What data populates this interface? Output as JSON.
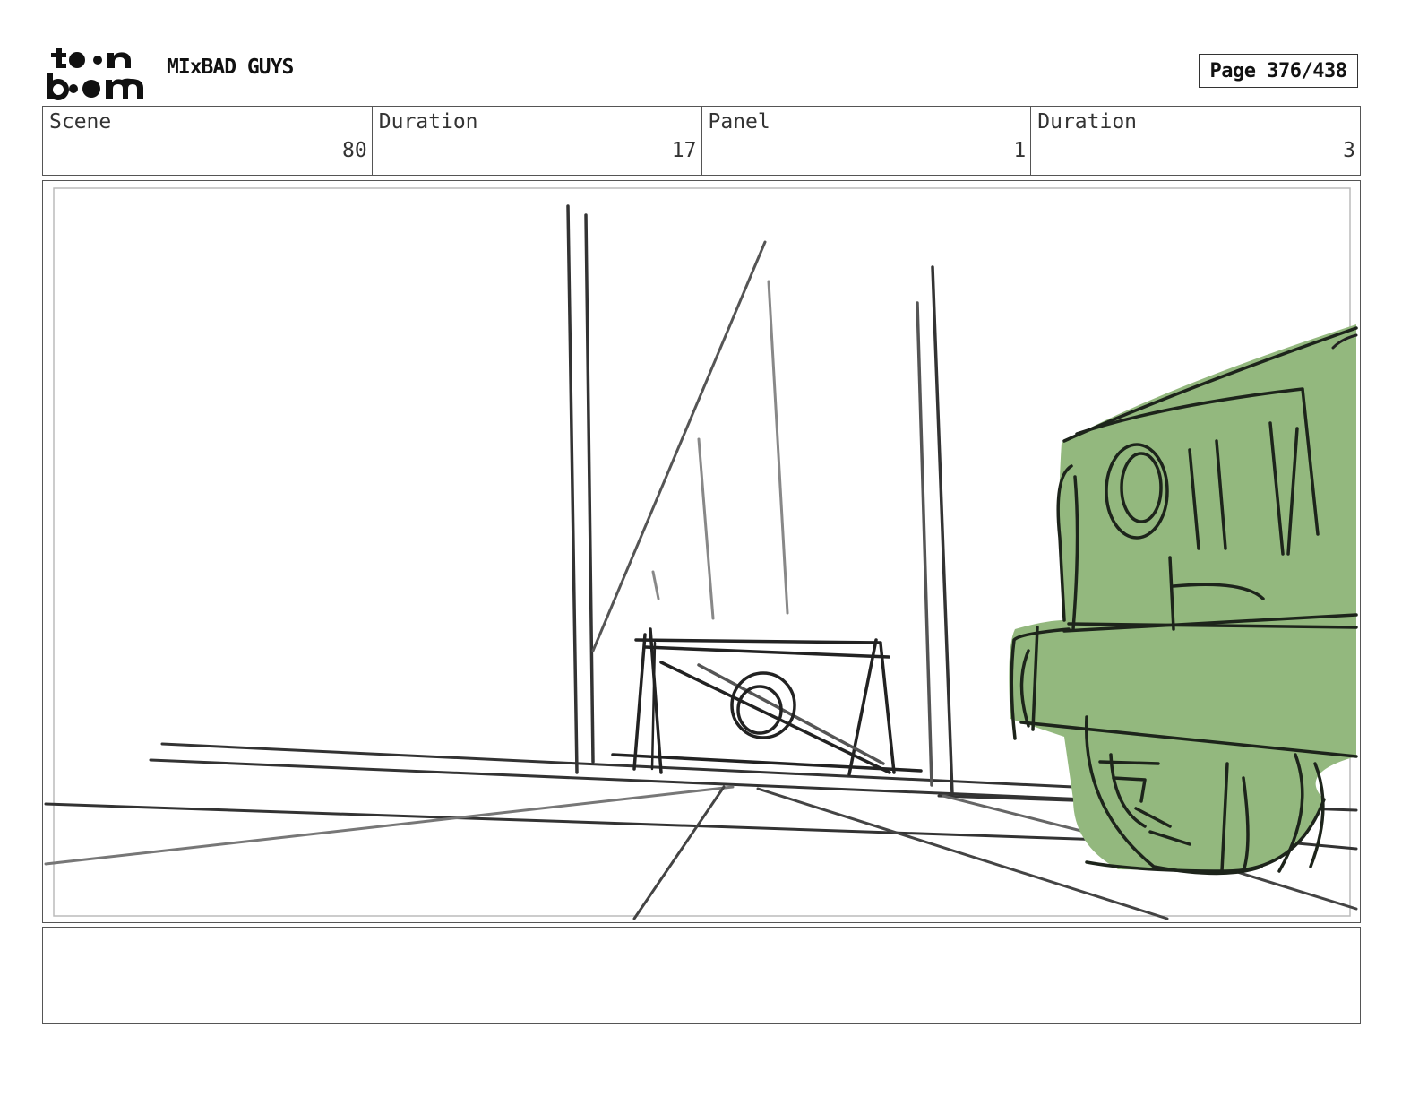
{
  "header": {
    "logo_text": "toon boom",
    "project_title": "MIxBAD GUYS",
    "page_label": "Page 376/438"
  },
  "info": {
    "scene_label": "Scene",
    "scene_value": "80",
    "scene_duration_label": "Duration",
    "scene_duration_value": "17",
    "panel_label": "Panel",
    "panel_value": "1",
    "panel_duration_label": "Duration",
    "panel_duration_value": "3"
  },
  "panel": {
    "fill_color": "#93b87e",
    "line_color": "#222222"
  },
  "notes": {
    "text": ""
  }
}
